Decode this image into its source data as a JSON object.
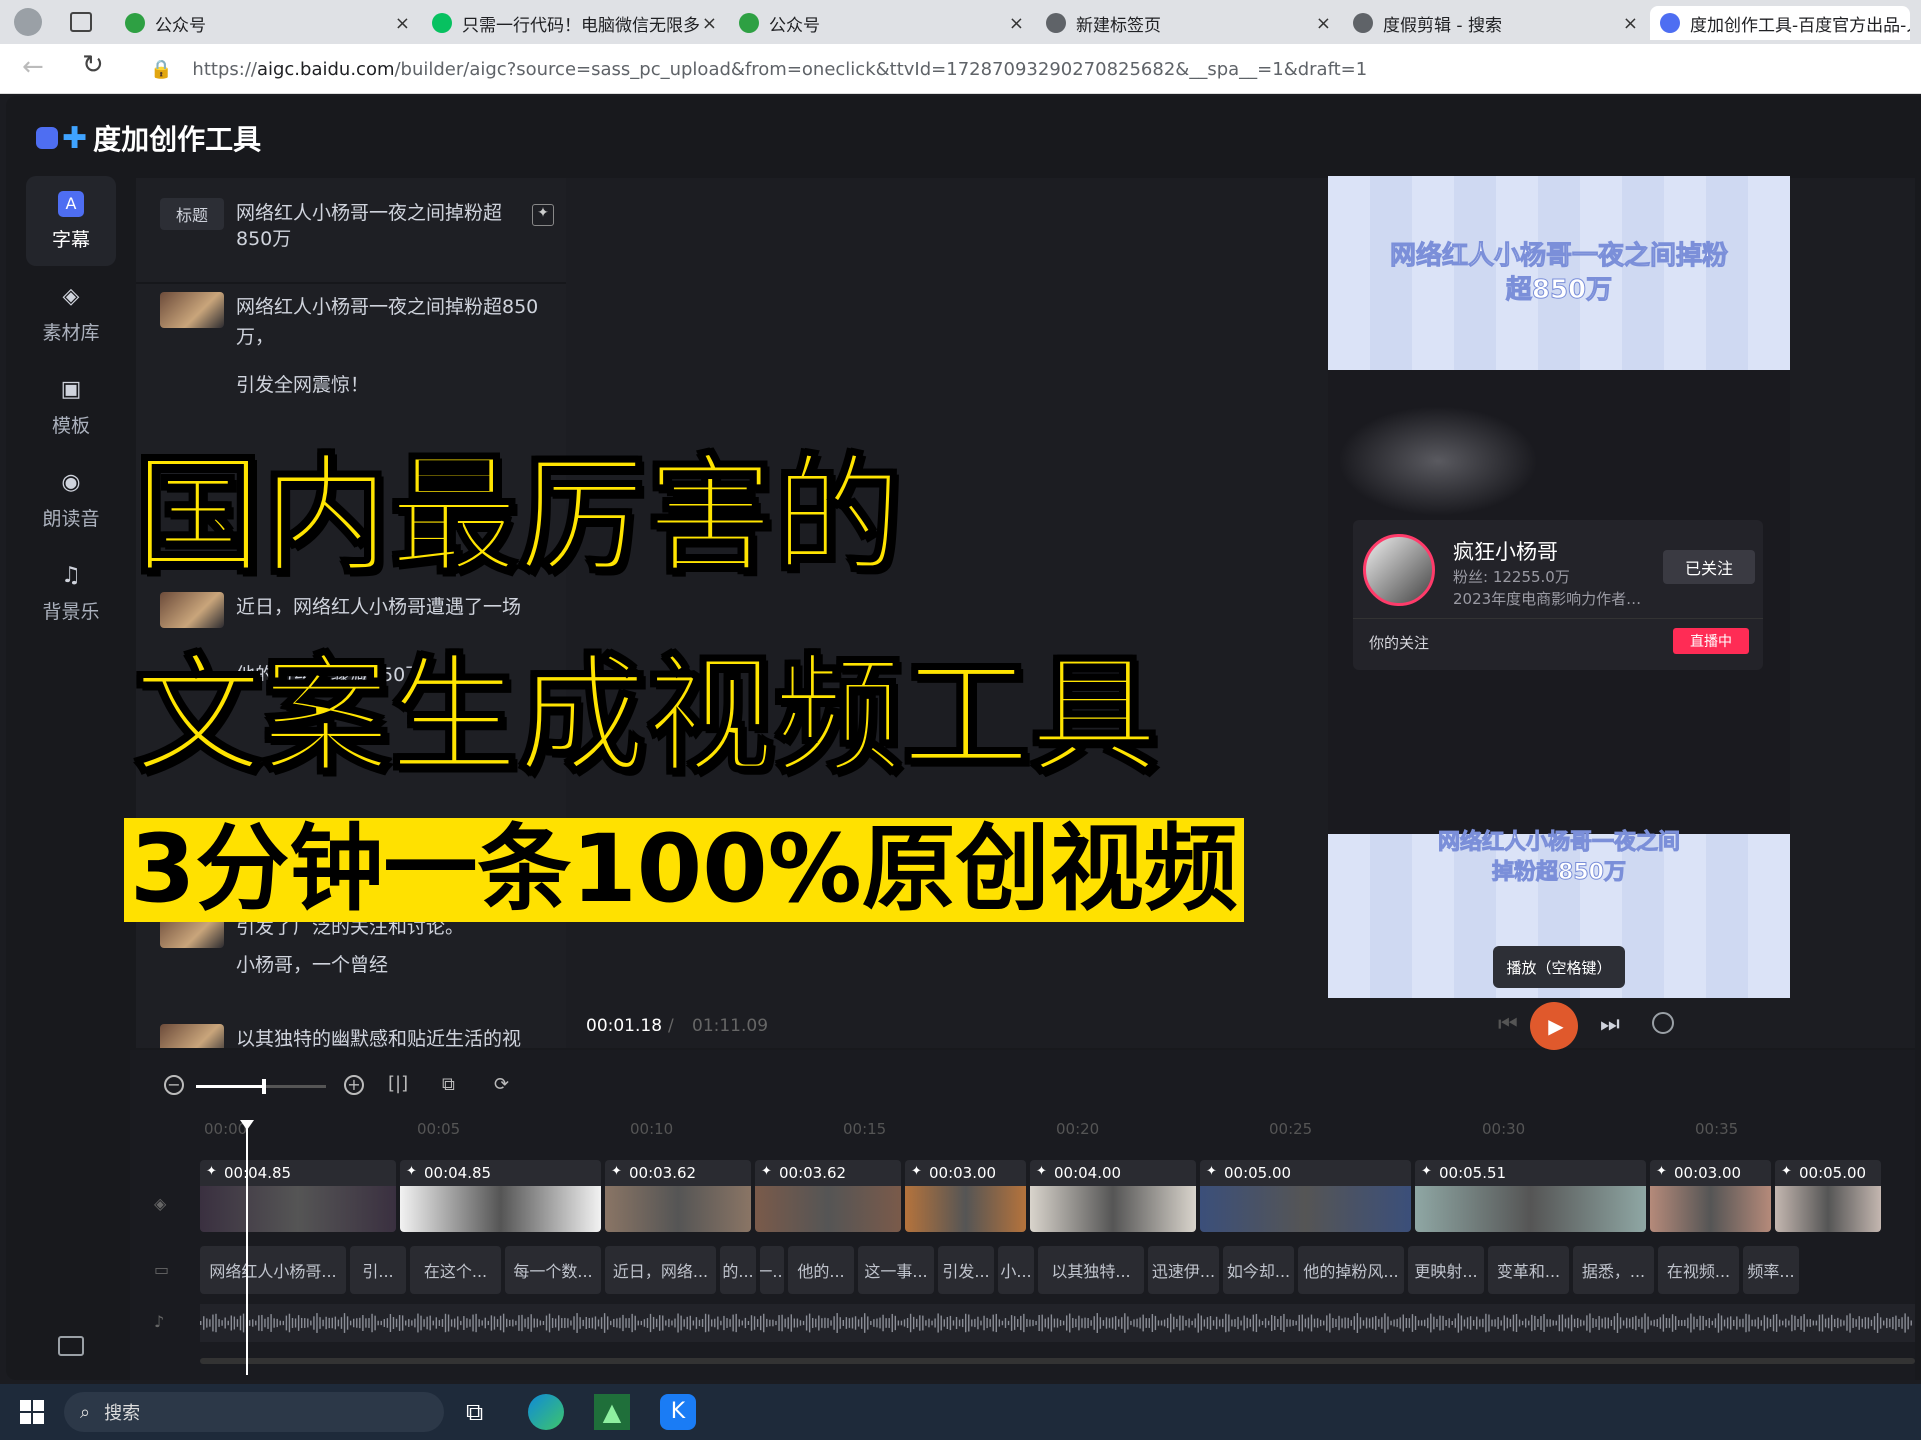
{
  "browser": {
    "tabs": [
      {
        "label": "公众号",
        "color": "#2ea043"
      },
      {
        "label": "只需一行代码！电脑微信无限多",
        "color": "#07c160"
      },
      {
        "label": "公众号",
        "color": "#2ea043"
      },
      {
        "label": "新建标签页",
        "color": "#5f6368"
      },
      {
        "label": "度假剪辑 - 搜索",
        "color": "#5f6368"
      },
      {
        "label": "度加创作工具-百度官方出品-人",
        "color": "#4e6ef2"
      }
    ],
    "url_prefix": "https://",
    "url_host": "aigc.baidu.com",
    "url_path": "/builder/aigc?source=sass_pc_upload&from=oneclick&ttvId=17287093290270825682&__spa__=1&draft=1"
  },
  "app": {
    "logo_text": "度加创作工具",
    "sidebar": [
      {
        "label": "字幕",
        "icon": "subtitle-icon",
        "glyph": "A",
        "active": true
      },
      {
        "label": "素材库",
        "icon": "layers-icon",
        "glyph": "◈",
        "active": false
      },
      {
        "label": "模板",
        "icon": "template-icon",
        "glyph": "▣",
        "active": false
      },
      {
        "label": "朗读音",
        "icon": "voice-icon",
        "glyph": "◉",
        "active": false
      },
      {
        "label": "背景乐",
        "icon": "music-icon",
        "glyph": "♫",
        "active": false
      }
    ],
    "script": {
      "title_tag": "标题",
      "title_text": "网络红人小杨哥一夜之间掉粉超850万",
      "rows": [
        {
          "lines": [
            "网络红人小杨哥一夜之间掉粉超850",
            "万，"
          ]
        },
        {
          "lines": [
            "引发全网震惊！"
          ]
        },
        {
          "lines": [
            "近日，网络红人小杨哥遭遇了一场"
          ]
        },
        {
          "lines": [
            "他的粉丝量骤减850万，"
          ]
        },
        {
          "lines": [
            "引发了广泛的关注和讨论。"
          ]
        },
        {
          "lines": [
            "小杨哥，一个曾经"
          ]
        },
        {
          "lines": [
            "以其独特的幽默感和贴近生活的视"
          ]
        }
      ]
    },
    "player": {
      "current_time": "00:01.18",
      "total_time": "01:11.09",
      "banner_top": "网络红人小杨哥一夜之间掉粉超850万",
      "banner_bottom": "网络红人小杨哥一夜之间掉粉超850万",
      "profile_name": "疯狂小杨哥",
      "profile_fans": "粉丝: 12255.0万",
      "profile_desc": "2023年度电商影响力作者…",
      "follow_label": "已关注",
      "your_follow": "你的关注",
      "live_badge": "直播中",
      "play_tooltip": "播放（空格键）"
    },
    "timeline": {
      "ruler": [
        "00:00",
        "00:05",
        "00:10",
        "00:15",
        "00:20",
        "00:25",
        "00:30",
        "00:35"
      ],
      "clips": [
        {
          "duration": "00:04.85",
          "w": 200
        },
        {
          "duration": "00:04.85",
          "w": 205
        },
        {
          "duration": "00:03.62",
          "w": 150
        },
        {
          "duration": "00:03.62",
          "w": 150
        },
        {
          "duration": "00:03.00",
          "w": 125
        },
        {
          "duration": "00:04.00",
          "w": 170
        },
        {
          "duration": "00:05.00",
          "w": 215
        },
        {
          "duration": "00:05.51",
          "w": 235
        },
        {
          "duration": "00:03.00",
          "w": 125
        },
        {
          "duration": "00:05.00",
          "w": 110
        }
      ],
      "subtitles": [
        "网络红人小杨哥...",
        "引...",
        "在这个...",
        "每一个数...",
        "近日，网络...",
        "的...",
        "一...",
        "他的...",
        "这一事...",
        "引发...",
        "小...",
        "以其独特...",
        "迅速伊...",
        "如今却...",
        "他的掉粉风...",
        "更映射...",
        "变革和...",
        "据悉，...",
        "在视频...",
        "频率..."
      ]
    }
  },
  "overlay": {
    "line1": "国内最厉害的",
    "line2": "文案生成视频工具",
    "line3": "3分钟一条100%原创视频"
  },
  "taskbar": {
    "search_label": "搜索"
  }
}
